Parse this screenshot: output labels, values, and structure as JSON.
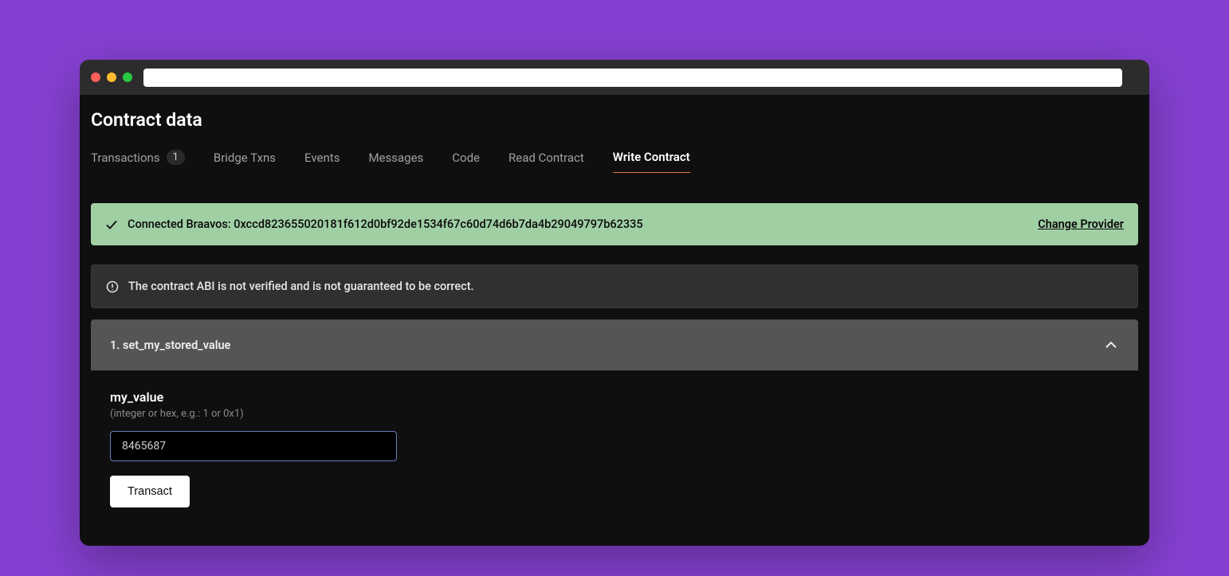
{
  "page": {
    "title": "Contract data"
  },
  "tabs": {
    "transactions": {
      "label": "Transactions",
      "badge": "1"
    },
    "bridge": {
      "label": "Bridge Txns"
    },
    "events": {
      "label": "Events"
    },
    "messages": {
      "label": "Messages"
    },
    "code": {
      "label": "Code"
    },
    "read": {
      "label": "Read Contract"
    },
    "write": {
      "label": "Write Contract"
    }
  },
  "banner": {
    "connected_text": "Connected Braavos: 0xccd823655020181f612d0bf92de1534f67c60d74d6b7da4b29049797b62335",
    "change_provider": "Change Provider"
  },
  "warning": {
    "text": "The contract ABI is not verified and is not guaranteed to be correct."
  },
  "function": {
    "title": "1. set_my_stored_value",
    "param_label": "my_value",
    "param_hint": "(integer or hex, e.g.: 1 or 0x1)",
    "param_value": "8465687",
    "transact_label": "Transact"
  }
}
